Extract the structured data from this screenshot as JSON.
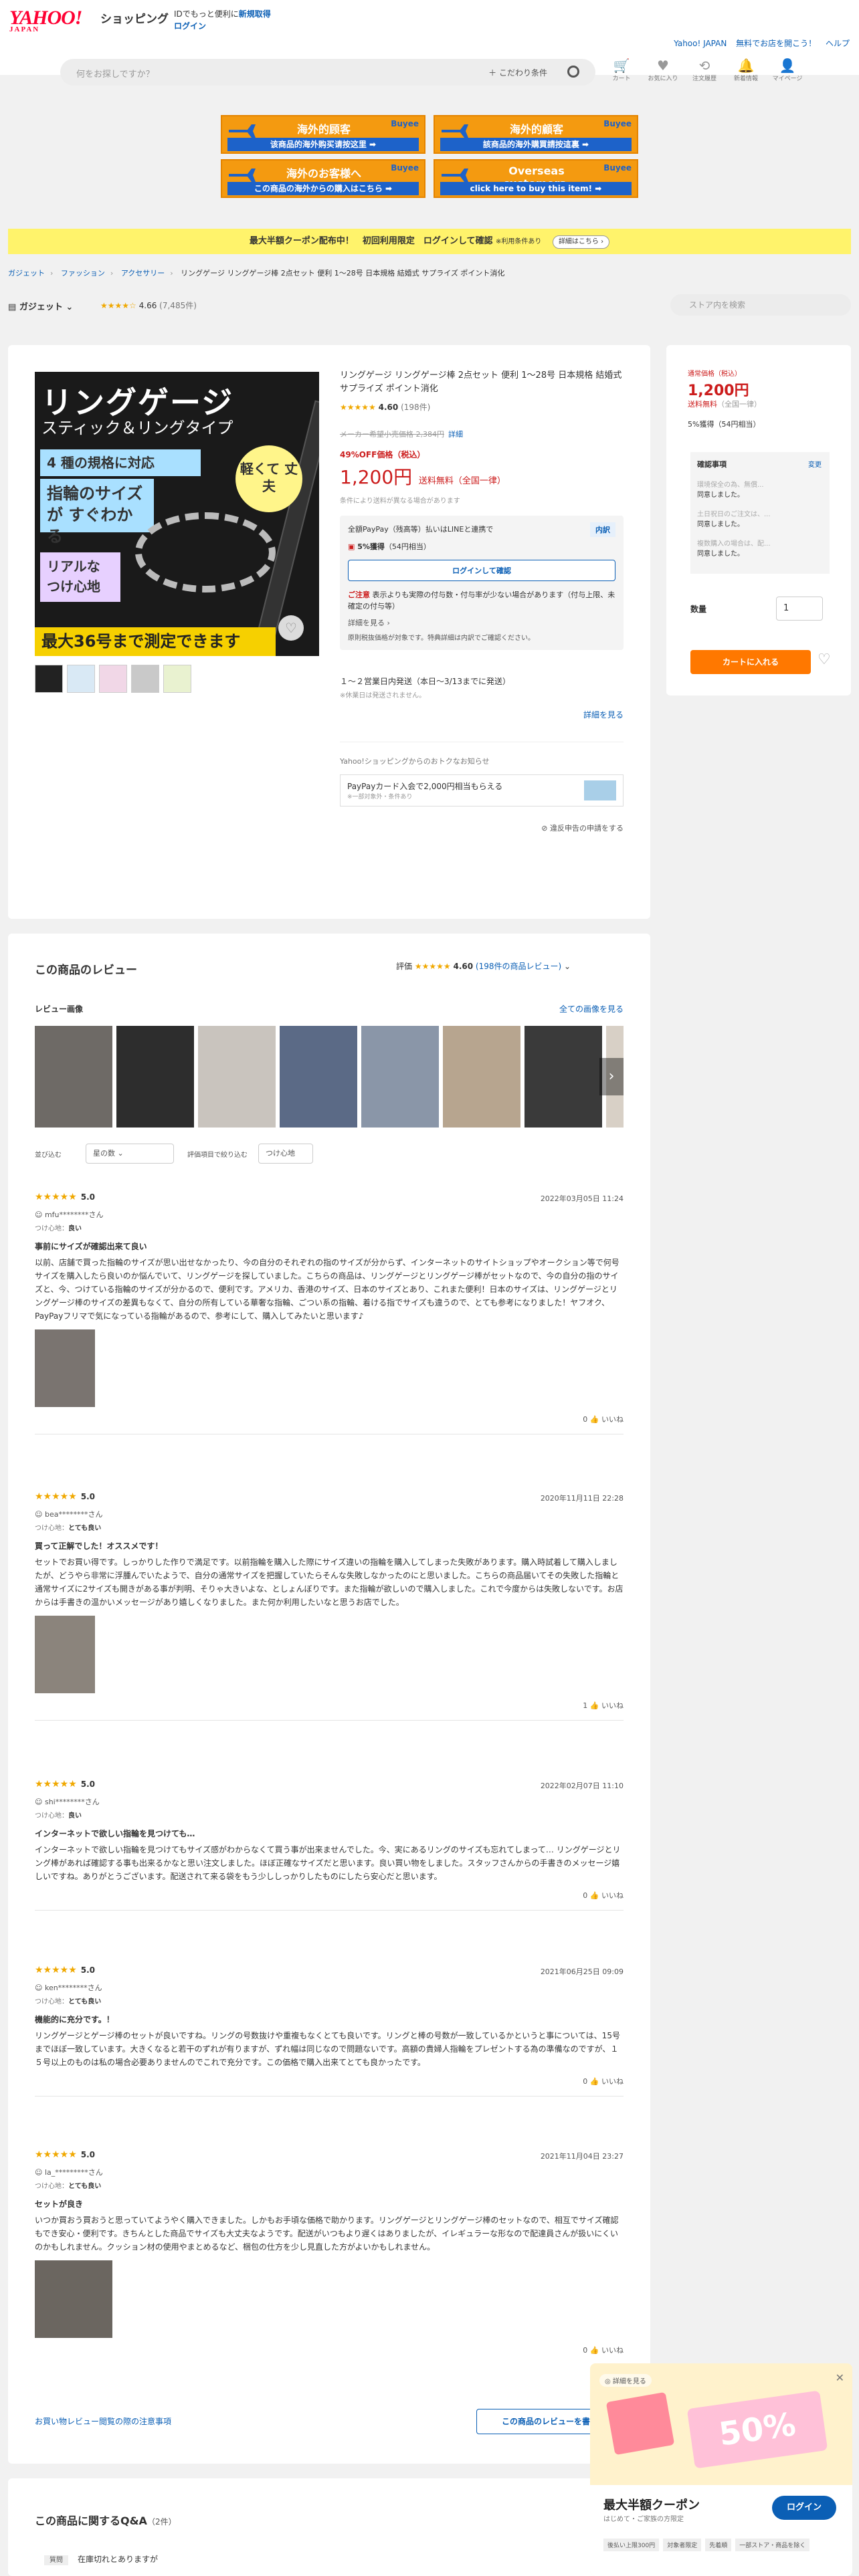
{
  "header": {
    "logo_main": "YAHOO!",
    "logo_sub": "JAPAN",
    "shop_name": "ショッピング",
    "msg_prefix": "IDでもっと便利に",
    "msg_link": "新規取得",
    "login": "ログイン",
    "right_links": [
      "Yahoo! JAPAN",
      "無料でお店を開こう！",
      "ヘルプ"
    ],
    "search_placeholder": "何をお探しですか？",
    "search_condition": "＋ こだわり条件",
    "icons": [
      {
        "name": "cart-icon",
        "label": "カート",
        "glyph": "🛒"
      },
      {
        "name": "favorite-icon",
        "label": "お気に入り",
        "glyph": "♥"
      },
      {
        "name": "history-icon",
        "label": "注文履歴",
        "glyph": "⟲"
      },
      {
        "name": "bell-icon",
        "label": "新着情報",
        "glyph": "🔔"
      },
      {
        "name": "user-icon",
        "label": "マイページ",
        "glyph": "👤"
      }
    ]
  },
  "banners": [
    {
      "title": "海外的顾客",
      "sub": "该商品的海外购买请按这里 ➡",
      "brand": "Buyee"
    },
    {
      "title": "海外的顧客",
      "sub": "該商品的海外購買請按這裏 ➡",
      "brand": "Buyee"
    },
    {
      "title": "海外のお客様へ",
      "sub": "この商品の海外からの購入はこちら ➡",
      "brand": "Buyee"
    },
    {
      "title": "Overseas customers,",
      "sub": "click here to buy this item! ➡",
      "brand": "Buyee"
    }
  ],
  "coupon_bar": {
    "text": "最大半額クーポン配布中！　初回利用限定　ログインして確認",
    "note": "※利用条件あり",
    "detail": "詳細はこちら ›"
  },
  "breadcrumb": [
    "ガジェット",
    "ファッション",
    "アクセサリー"
  ],
  "breadcrumb_current": "リングゲージ リングゲージ棒 2点セット 便利 1〜28号 日本規格 結婚式 サプライズ ポイント消化",
  "store": {
    "name": "ガジェット",
    "stars": "★★★★☆",
    "rating": "4.66",
    "count": "(7,485件)",
    "search_placeholder": "ストア内を検索"
  },
  "main_image": {
    "title": "リングゲージ",
    "subtitle": "スティック＆リングタイプ",
    "box1": "4 種の規格に対応",
    "box2": "指輪のサイズが すぐわかる",
    "box3": "リアルな つけ心地",
    "circle": "軽くて 丈夫",
    "bottom": "最大36号まで測定できます"
  },
  "product": {
    "title": "リングゲージ リングゲージ棒 2点セット 便利 1〜28号 日本規格 結婚式 サプライズ ポイント消化",
    "stars": "★★★★★",
    "rating": "4.60",
    "rating_count": "(198件)",
    "old_price": "メーカー希望小売価格 2,384円",
    "old_price_link": "詳細",
    "off": "49%OFF価格（税込）",
    "price": "1,200円",
    "shipping": "送料無料（全国一律）",
    "price_note": "条件により送料が異なる場合があります",
    "pay_text": "全額PayPay（残高等）払いはLINEと連携で",
    "pay_badge": "内訳",
    "points": "5%獲得",
    "points_detail": "（54円相当）",
    "login_btn": "ログインして確認",
    "attention_label": "ご注意",
    "attention": "表示よりも実際の付与数・付与率が少ない場合があります（付与上限、未確定の付与等）",
    "more": "詳細を見る ›",
    "mini_note": "原則税抜価格が対象です。特典詳細は内訳でご確認ください。",
    "ship_text": "１〜２営業日内発送（本日〜3/13までに発送）",
    "ship_note": "※休業日は発送されません。",
    "detail_link": "詳細を見る",
    "otoku_label": "Yahoo!ショッピングからのおトクなお知らせ",
    "paypay_card": "PayPayカード入会で2,000円相当もらえる",
    "paypay_card_note": "※一部対象外・条件あり",
    "report": "⊘ 違反申告の申請をする"
  },
  "side": {
    "label": "通常価格（税込）",
    "price": "1,200円",
    "shipping": "送料無料",
    "shipping_note": "（全国一律）",
    "points": "5%獲得（54円相当）",
    "check_title": "確認事項",
    "check_change": "変更",
    "check_items": [
      {
        "q": "環境保全の為、無償...",
        "a": "同意しました。"
      },
      {
        "q": "土日祝日のご注文は、...",
        "a": "同意しました。"
      },
      {
        "q": "複数購入の場合は、配...",
        "a": "同意しました。"
      }
    ],
    "qty_label": "数量",
    "qty": "1",
    "cart": "カートに入れる"
  },
  "reviews_section": {
    "title": "この商品のレビュー",
    "score_label": "評価",
    "stars": "★★★★★",
    "score": "4.60",
    "count_link": "(198件の商品レビュー)",
    "images_label": "レビュー画像",
    "images_all": "全ての画像を見る",
    "sort_label": "並び込む",
    "sort_value": "星の数",
    "filter_label": "評価項目で絞り込む",
    "filter_value": "つけ心地",
    "footer_link": "お買い物レビュー閲覧の際の注意事項",
    "footer_btn": "この商品のレビューを書く"
  },
  "reviews": [
    {
      "stars": "★★★★★",
      "score": "5.0",
      "date": "2022年03月05日 11:24",
      "user": "mfu********さん",
      "fit": "良い",
      "title": "事前にサイズが確認出来て良い",
      "body": "以前、店舗で買った指輪のサイズが思い出せなかったり、今の自分のそれぞれの指のサイズが分からず、インターネットのサイトショップやオークション等で何号サイズを購入したら良いのか悩んでいて、リングゲージを探していました。こちらの商品は、リングゲージとリングゲージ棒がセットなので、今の自分の指のサイズと、今、つけている指輪のサイズが分かるので、便利です。アメリカ、香港のサイズ、日本のサイズとあり、これまた便利！日本のサイズは、リングゲージとリングゲージ棒のサイズの差異もなくて、自分の所有している華奢な指輪、ごつい系の指輪、着ける指でサイズも違うので、とても参考になりました！ヤフオク、PayPayフリマで気になっている指輪があるので、参考にして、購入してみたいと思います♪",
      "helpful": "0"
    },
    {
      "stars": "★★★★★",
      "score": "5.0",
      "date": "2020年11月11日 22:28",
      "user": "bea********さん",
      "fit": "とても良い",
      "title": "買って正解でした！オススメです！",
      "body": "セットでお買い得です。しっかりした作りで満足です。以前指輪を購入した際にサイズ違いの指輪を購入してしまった失敗があります。購入時試着して購入しましたが、どうやら非常に浮腫んでいたようで、自分の通常サイズを把握していたらそんな失敗しなかったのにと思いました。こちらの商品届いてその失敗した指輪と通常サイズに2サイズも開きがある事が判明、そりゃ大きいよな、としょんぼりです。また指輪が欲しいので購入しました。これで今度からは失敗しないです。お店からは手書きの温かいメッセージがあり嬉しくなりました。また何か利用したいなと思うお店でした。",
      "helpful": "1"
    },
    {
      "stars": "★★★★★",
      "score": "5.0",
      "date": "2022年02月07日 11:10",
      "user": "shi********さん",
      "fit": "良い",
      "title": "インターネットで欲しい指輪を見つけても…",
      "body": "インターネットで欲しい指輪を見つけてもサイズ感がわからなくて買う事が出来ませんでした。今、実にあるリングのサイズも忘れてしまって… リングゲージとリング棒があれば確認する事も出来るかなと思い注文しました。ほぼ正確なサイズだと思います。良い買い物をしました。スタッフさんからの手書きのメッセージ嬉しいですね。ありがとうございます。配送されて来る袋をもう少ししっかりしたものにしたら安心だと思います。",
      "helpful": "0"
    },
    {
      "stars": "★★★★★",
      "score": "5.0",
      "date": "2021年06月25日 09:09",
      "user": "ken********さん",
      "fit": "とても良い",
      "title": "機能的に充分です。！",
      "body": "リングゲージとゲージ棒のセットが良いですね。リングの号数抜けや重複もなくとても良いです。リングと棒の号数が一致しているかというと事については、15号までほぼ一致しています。大きくなると若干のずれが有りますが、ずれ幅は同じなので問題ないです。高額の貴婦人指輪をプレゼントする為の準備なのですが、１５号以上のものは私の場合必要ありませんのでこれで充分です。この価格で購入出来てとても良かったです。",
      "helpful": "0"
    },
    {
      "stars": "★★★★★",
      "score": "5.0",
      "date": "2021年11月04日 23:27",
      "user": "la_*********さん",
      "fit": "とても良い",
      "title": "セットが良き",
      "body": "いつか買おう買おうと思っていてようやく購入できました。しかもお手頃な価格で助かります。リングゲージとリングゲージ棒のセットなので、相互でサイズ確認もでき安心・便利です。きちんとした商品でサイズも大丈夫なようです。配送がいつもより遅くはありましたが、イレギュラーな形なので配達員さんが扱いにくいのかもしれません。クッション材の使用やまとめるなど、梱包の仕方を少し見直した方がよいかもしれません。",
      "helpful": "0"
    }
  ],
  "review_ui": {
    "fit_label": "つけ心地：",
    "helpful_suffix": "いいね"
  },
  "qa": {
    "title": "この商品に関するQ&A",
    "count": "（2件）",
    "q_tag": "質問",
    "q_text": "在庫切れとありますが"
  },
  "popup": {
    "tag": "◎ 詳細を見る",
    "pct": "50%",
    "title": "最大半額クーポン",
    "subtitle": "はじめて・ご家族の方限定",
    "login": "ログイン",
    "tags": [
      "後払い上限300円",
      "対象者限定",
      "先着順",
      "一部ストア・商品を除く"
    ]
  }
}
